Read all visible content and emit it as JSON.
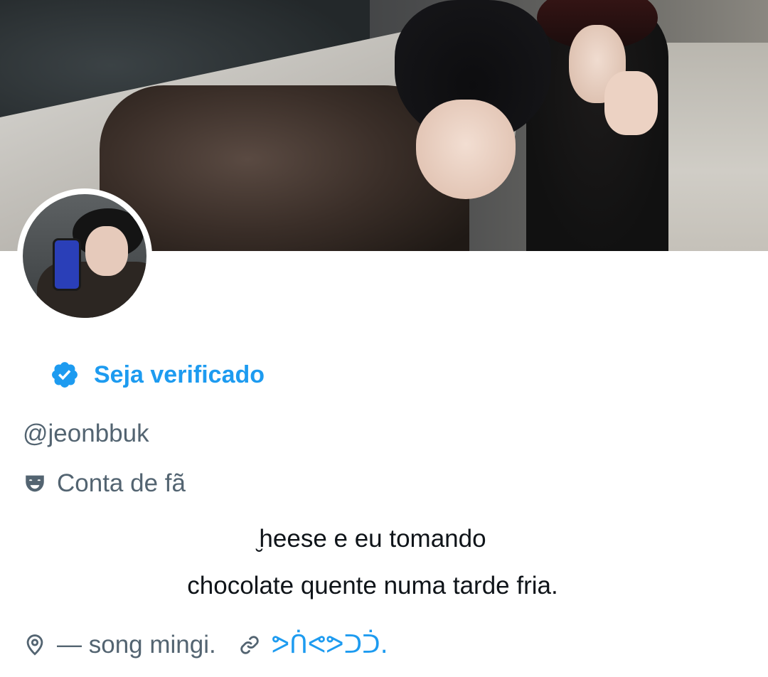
{
  "profile": {
    "verify_label": "Seja verificado",
    "handle": "@jeonbbuk",
    "category": "Conta de fã",
    "bio_line1": "̮heese e eu tomando",
    "bio_line2": "chocolate quente numa tarde fria.",
    "location": "— song mingi.",
    "link": "ᕗᑏᕙᕗᑐᑑ."
  },
  "icons": {
    "verify": "verified-badge-icon",
    "category": "theater-mask-icon",
    "location": "location-pin-icon",
    "link": "link-icon"
  },
  "colors": {
    "accent": "#1d9bf0",
    "secondary_text": "#536471",
    "primary_text": "#0f1419"
  }
}
